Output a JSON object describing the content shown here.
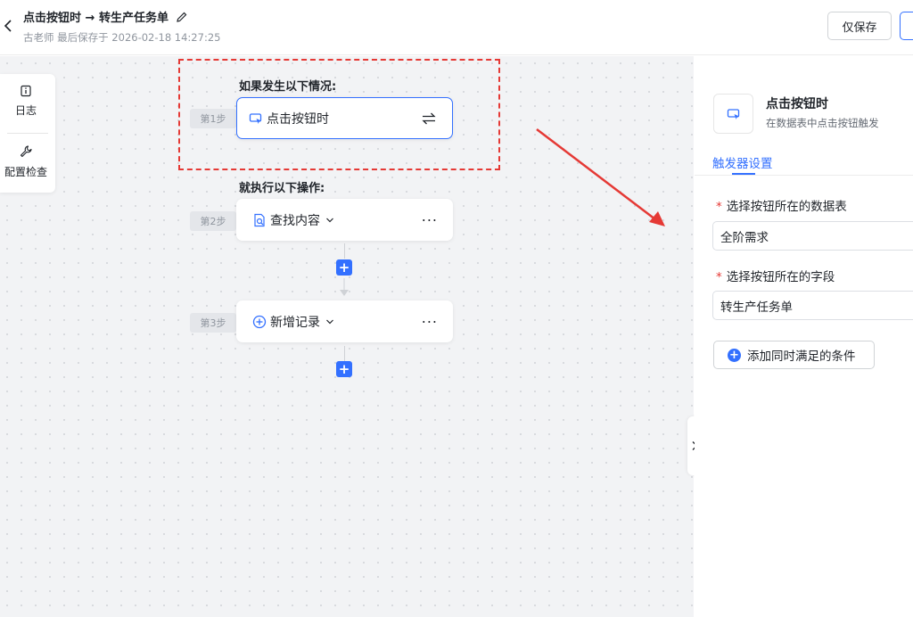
{
  "header": {
    "title": "点击按钮时 → 转生产任务单",
    "subtitle": "古老师 最后保存于 2026-02-18 14:27:25",
    "save_label": "仅保存"
  },
  "tools": [
    {
      "label": "日志",
      "icon": "info-icon"
    },
    {
      "label": "配置检查",
      "icon": "wrench-icon"
    }
  ],
  "flow": {
    "trigger_heading": "如果发生以下情况:",
    "action_heading": "就执行以下操作:",
    "steps": [
      {
        "tag": "第1步",
        "title": "点击按钮时",
        "icon": "button-click-icon"
      },
      {
        "tag": "第2步",
        "title": "查找内容",
        "icon": "find-record-icon"
      },
      {
        "tag": "第3步",
        "title": "新增记录",
        "icon": "add-record-icon"
      }
    ]
  },
  "panel": {
    "title": "点击按钮时",
    "description": "在数据表中点击按钮触发",
    "tab": "触发器设置",
    "fields": [
      {
        "label": "选择按钮所在的数据表",
        "required_mark": "*",
        "value": "全阶需求"
      },
      {
        "label": "选择按钮所在的字段",
        "required_mark": "*",
        "value": "转生产任务单"
      }
    ],
    "add_condition_label": "添加同时满足的条件"
  },
  "colors": {
    "accent": "#3370ff",
    "annotation": "#e53935"
  }
}
